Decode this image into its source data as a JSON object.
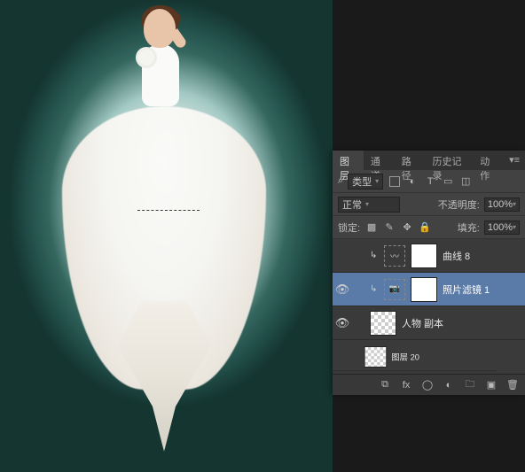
{
  "panel": {
    "tabs": [
      "图层",
      "通道",
      "路径",
      "历史记录",
      "动作"
    ],
    "active_tab": 0,
    "filter_kind": "类型",
    "blend_mode": "正常",
    "opacity_label": "不透明度:",
    "opacity_value": "100%",
    "lock_label": "锁定:",
    "fill_label": "填充:",
    "fill_value": "100%"
  },
  "layers": [
    {
      "visible": false,
      "name": "曲线 8",
      "type": "adjustment",
      "mask": true,
      "selected": false
    },
    {
      "visible": true,
      "name": "照片滤镜 1",
      "type": "adjustment",
      "mask": true,
      "selected": true
    },
    {
      "visible": true,
      "name": "人物 副本",
      "type": "raster",
      "mask": false,
      "selected": false
    },
    {
      "visible": false,
      "name": "图层 20",
      "type": "raster",
      "mask": false,
      "selected": false
    }
  ],
  "icons": {
    "kind": "类型",
    "search": "⌕",
    "fx": "fx",
    "trash": "🗑"
  }
}
